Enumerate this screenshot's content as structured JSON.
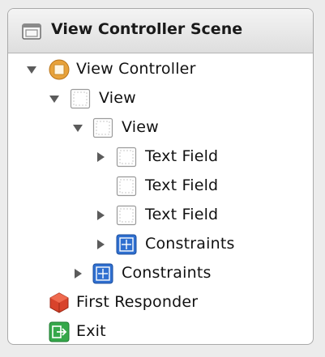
{
  "scene": {
    "title": "View Controller Scene",
    "icon": "scene-icon"
  },
  "outline": [
    {
      "label": "View Controller",
      "icon": "view-controller-icon",
      "disclosure": "expanded"
    },
    {
      "label": "View",
      "icon": "view-icon",
      "disclosure": "expanded"
    },
    {
      "label": "View",
      "icon": "view-icon",
      "disclosure": "expanded"
    },
    {
      "label": "Text Field",
      "icon": "text-field-icon",
      "disclosure": "collapsed"
    },
    {
      "label": "Text Field",
      "icon": "text-field-icon",
      "disclosure": "none"
    },
    {
      "label": "Text Field",
      "icon": "text-field-icon",
      "disclosure": "collapsed"
    },
    {
      "label": "Constraints",
      "icon": "constraints-icon",
      "disclosure": "collapsed"
    },
    {
      "label": "Constraints",
      "icon": "constraints-icon",
      "disclosure": "collapsed"
    },
    {
      "label": "First Responder",
      "icon": "first-responder-icon",
      "disclosure": "none"
    },
    {
      "label": "Exit",
      "icon": "exit-icon",
      "disclosure": "none"
    }
  ],
  "colors": {
    "disclosure": "#5b5b5b",
    "view_controller": "#e8a23a",
    "constraints": "#2f6fd0",
    "first_responder": "#d8432b",
    "exit": "#35a84a"
  }
}
